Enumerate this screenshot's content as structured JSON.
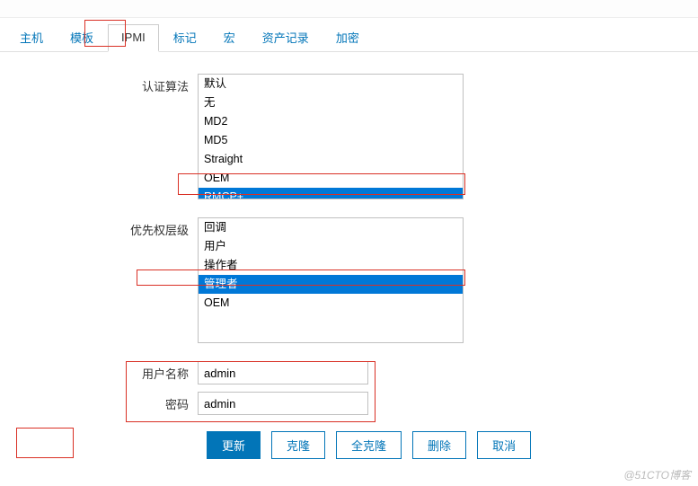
{
  "tabs": [
    "主机",
    "模板",
    "IPMI",
    "标记",
    "宏",
    "资产记录",
    "加密"
  ],
  "active_tab": "IPMI",
  "form": {
    "auth_algo_label": "认证算法",
    "auth_algo_options": [
      "默认",
      "无",
      "MD2",
      "MD5",
      "Straight",
      "OEM",
      "RMCP+"
    ],
    "auth_algo_selected": "RMCP+",
    "priv_level_label": "优先权层级",
    "priv_level_options": [
      "回调",
      "用户",
      "操作者",
      "管理者",
      "OEM"
    ],
    "priv_level_selected": "管理者",
    "username_label": "用户名称",
    "username_value": "admin",
    "password_label": "密码",
    "password_value": "admin"
  },
  "buttons": {
    "update": "更新",
    "clone": "克隆",
    "full_clone": "全克隆",
    "delete": "删除",
    "cancel": "取消"
  },
  "watermark": "@51CTO博客"
}
